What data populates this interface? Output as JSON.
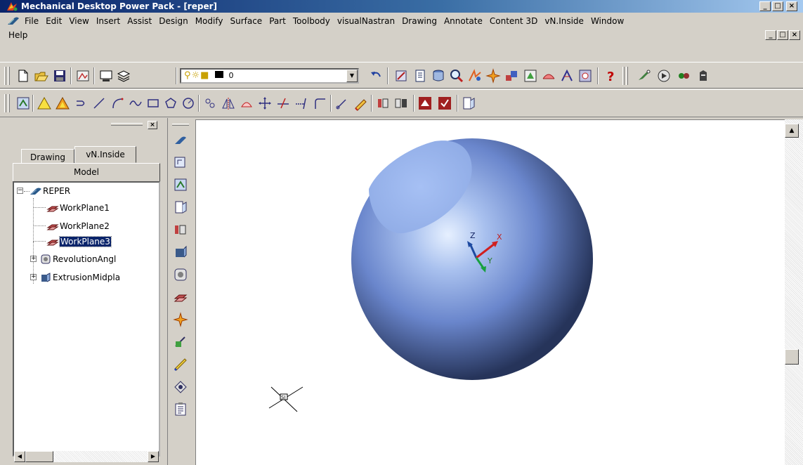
{
  "window": {
    "title": "Mechanical Desktop Power Pack - [reper]",
    "controls": [
      "_",
      "□",
      "×"
    ]
  },
  "menu": {
    "items": [
      "File",
      "Edit",
      "View",
      "Insert",
      "Assist",
      "Design",
      "Modify",
      "Surface",
      "Part",
      "Toolbody",
      "visualNastran",
      "Drawing",
      "Annotate",
      "Content 3D",
      "vN.Inside",
      "Window"
    ],
    "help": "Help",
    "mdi_controls": [
      "_",
      "□",
      "×"
    ]
  },
  "toolbar1": {
    "layer_value": "0",
    "help_glyph": "?"
  },
  "browser": {
    "close_glyph": "×",
    "tabs": [
      "Drawing",
      "vN.Inside",
      "Model"
    ],
    "active_tab": "Model",
    "tree": {
      "root": "REPER",
      "items": [
        "WorkPlane1",
        "WorkPlane2",
        "WorkPlane3",
        "RevolutionAngl",
        "ExtrusionMidpla"
      ],
      "selected": "WorkPlane3"
    }
  },
  "viewport": {
    "axis_labels": {
      "z": "Z",
      "x": "X",
      "y": "Y"
    },
    "ucs_label": "SI"
  },
  "colors": {
    "title_gradient_start": "#0a246a",
    "title_gradient_end": "#a6caf0",
    "selection": "#0a246a",
    "sphere_light": "#e6f0ff",
    "sphere_dark": "#26345a"
  }
}
